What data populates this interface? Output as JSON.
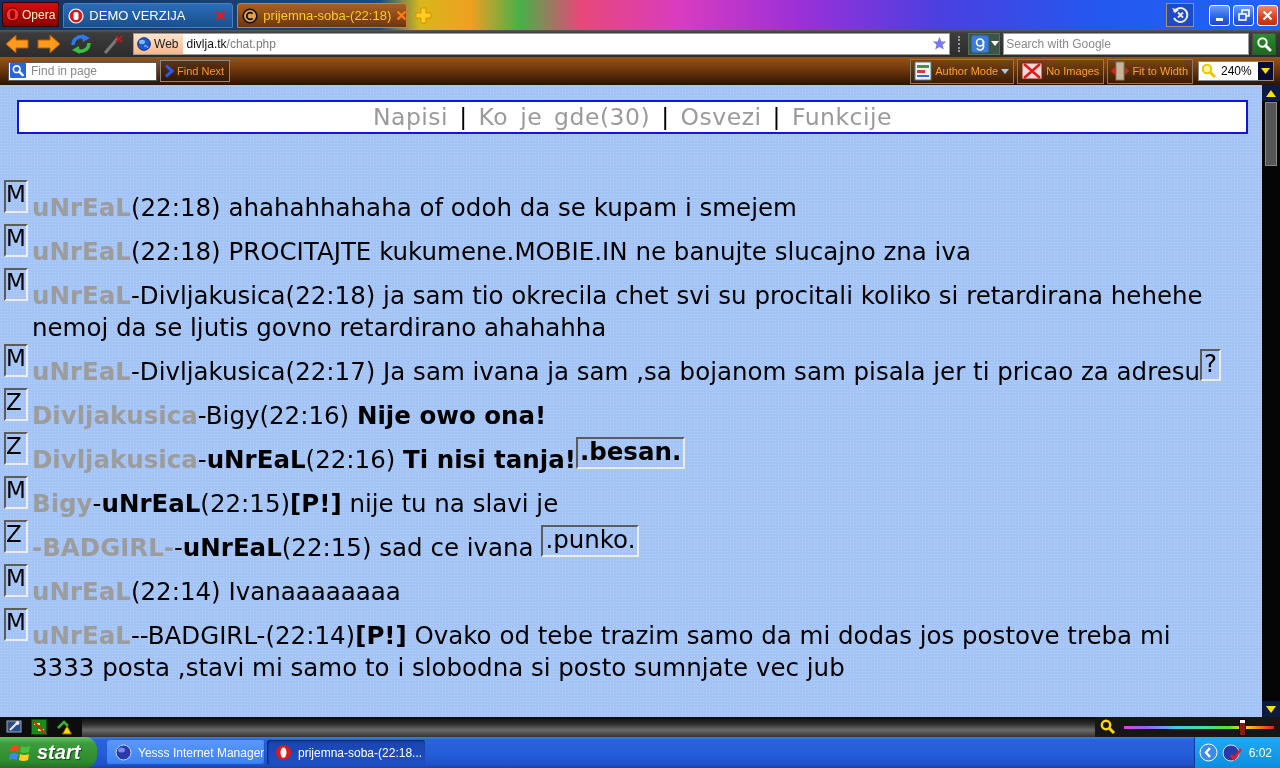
{
  "tabbar": {
    "menu_label": "Opera",
    "tabs": [
      {
        "title": "DEMO VERZIJA",
        "selected": false
      },
      {
        "title": "prijemna-soba-(22:18)",
        "selected": true
      }
    ]
  },
  "address_bar": {
    "badge": "Web",
    "host": "divlja.tk",
    "path": "/chat.php",
    "search_placeholder": "Search with Google"
  },
  "find_bar": {
    "placeholder": "Find in page",
    "find_next": "Find Next",
    "author_mode": "Author Mode",
    "no_images": "No Images",
    "fit_to_width": "Fit to Width",
    "zoom": "240%"
  },
  "page": {
    "nav": {
      "separator": "|",
      "links": [
        "Napisi",
        "Ko je gde(30)",
        "Osvezi",
        "Funkcije"
      ]
    },
    "messages": [
      {
        "badge": "M",
        "sender": "uNrEaL",
        "text": "(22:18) ahahahhahaha of odoh da se kupam i smejem"
      },
      {
        "badge": "M",
        "sender": "uNrEaL",
        "text": "(22:18) PROCITAJTE kukumene.MOBIE.IN ne banujte slucajno zna iva"
      },
      {
        "badge": "M",
        "sender": "uNrEaL",
        "text": "-Divljakusica(22:18) ja sam tio okrecila chet svi su procitali koliko si retardirana hehehe nemoj da se ljutis govno retardirano ahahahha"
      },
      {
        "badge": "M",
        "sender": "uNrEaL",
        "text": "-Divljakusica(22:17) Ja sam ivana ja sam ,sa bojanom sam pisala jer ti pricao za adresu",
        "emoticon": {
          "label": "?",
          "bold": false
        }
      },
      {
        "badge": "Z",
        "sender": "Divljakusica",
        "text": "-Bigy(22:16) **Nije owo ona!**"
      },
      {
        "badge": "Z",
        "sender": "Divljakusica",
        "text": "-**uNrEaL**(22:16) **Ti nisi tanja!**",
        "emoticon": {
          "label": ".besan.",
          "bold": true
        }
      },
      {
        "badge": "M",
        "sender": "Bigy",
        "text": "-**uNrEaL**(22:15)**[P!]** nije tu na slavi je"
      },
      {
        "badge": "Z",
        "sender": "-BADGIRL-",
        "text": "-**uNrEaL**(22:15) sad ce ivana ",
        "emoticon": {
          "label": ".punko.",
          "bold": false
        }
      },
      {
        "badge": "M",
        "sender": "uNrEaL",
        "text": "(22:14) Ivanaaaaaaaa"
      },
      {
        "badge": "M",
        "sender": "uNrEaL",
        "text": "--BADGIRL-(22:14)**[P!]** Ovako od tebe trazim samo da mi dodas jos postove treba mi 3333 posta ,stavi mi samo to i slobodna si posto sumnjate vec jub"
      }
    ]
  },
  "status_bar": {
    "zoom_slider": {
      "level": 0.79
    }
  },
  "taskbar": {
    "start": "start",
    "tasks": [
      {
        "title": "Yesss Internet Manager",
        "selected": false
      },
      {
        "title": "prijemna-soba-(22:18...",
        "selected": true
      }
    ],
    "clock": "6:02"
  }
}
